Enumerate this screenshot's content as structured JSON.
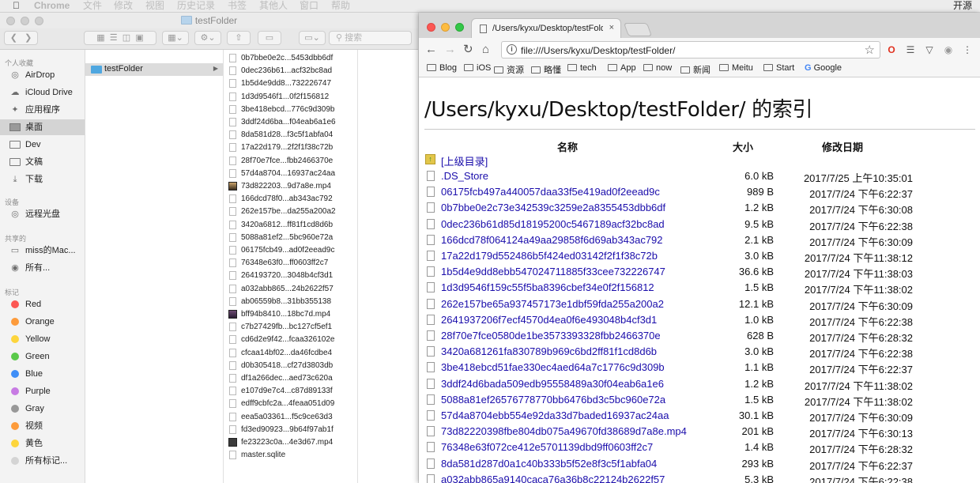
{
  "menubar": {
    "app": "Chrome",
    "items": [
      "文件",
      "修改",
      "视图",
      "历史记录",
      "书签",
      "其他人",
      "窗口",
      "帮助"
    ],
    "right_text": "开源"
  },
  "finder": {
    "title": "testFolder",
    "search_placeholder": "搜索",
    "sidebar": {
      "favorites_header": "个人收藏",
      "favorites": [
        {
          "label": "AirDrop",
          "icon": "airdrop-icon"
        },
        {
          "label": "iCloud Drive",
          "icon": "cloud-icon"
        },
        {
          "label": "应用程序",
          "icon": "applications-icon"
        },
        {
          "label": "桌面",
          "icon": "desktop-icon",
          "selected": true
        },
        {
          "label": "Dev",
          "icon": "folder-icon"
        },
        {
          "label": "文稿",
          "icon": "documents-icon"
        },
        {
          "label": "下载",
          "icon": "download-icon"
        }
      ],
      "devices_header": "设备",
      "devices": [
        {
          "label": "远程光盘",
          "icon": "disc-icon"
        }
      ],
      "shared_header": "共享的",
      "shared": [
        {
          "label": "miss的Mac...",
          "icon": "computer-icon"
        },
        {
          "label": "所有...",
          "icon": "network-icon"
        }
      ],
      "tags_header": "标记",
      "tags": [
        {
          "label": "Red",
          "color": "#fc5753"
        },
        {
          "label": "Orange",
          "color": "#fd9b3b"
        },
        {
          "label": "Yellow",
          "color": "#fdd53c"
        },
        {
          "label": "Green",
          "color": "#5ac94a"
        },
        {
          "label": "Blue",
          "color": "#3e8ef7"
        },
        {
          "label": "Purple",
          "color": "#c77be3"
        },
        {
          "label": "Gray",
          "color": "#989898"
        },
        {
          "label": "视频",
          "color": "#fd9b3b"
        },
        {
          "label": "黄色",
          "color": "#fdd53c"
        },
        {
          "label": "所有标记...",
          "color": "#d4d4d4"
        }
      ]
    },
    "column1": {
      "selected_folder": "testFolder"
    },
    "column2_files": [
      {
        "name": "0b7bbe0e2c...5453dbb6df",
        "kind": "doc"
      },
      {
        "name": "0dec236b61...acf32bc8ad",
        "kind": "doc"
      },
      {
        "name": "1b5d4e9dd8...732226747",
        "kind": "doc"
      },
      {
        "name": "1d3d9546f1...0f2f156812",
        "kind": "doc"
      },
      {
        "name": "3be418ebcd...776c9d309b",
        "kind": "doc"
      },
      {
        "name": "3ddf24d6ba...f04eab6a1e6",
        "kind": "doc"
      },
      {
        "name": "8da581d28...f3c5f1abfa04",
        "kind": "doc"
      },
      {
        "name": "17a22d179...2f2f1f38c72b",
        "kind": "doc"
      },
      {
        "name": "28f70e7fce...fbb2466370e",
        "kind": "doc"
      },
      {
        "name": "57d4a8704...16937ac24aa",
        "kind": "doc"
      },
      {
        "name": "73d822203...9d7a8e.mp4",
        "kind": "video1"
      },
      {
        "name": "166dcd78f0...ab343ac792",
        "kind": "doc"
      },
      {
        "name": "262e157be...da255a200a2",
        "kind": "doc"
      },
      {
        "name": "3420a6812...ff81f1cd8d6b",
        "kind": "doc"
      },
      {
        "name": "5088a81ef2...5bc960e72a",
        "kind": "doc"
      },
      {
        "name": "06175fcb49...ad0f2eead9c",
        "kind": "doc"
      },
      {
        "name": "76348e63f0...ff0603ff2c7",
        "kind": "doc"
      },
      {
        "name": "264193720...3048b4cf3d1",
        "kind": "doc"
      },
      {
        "name": "a032abb865...24b2622f57",
        "kind": "doc"
      },
      {
        "name": "ab06559b8...31bb355138",
        "kind": "doc"
      },
      {
        "name": "bff94b8410...18bc7d.mp4",
        "kind": "video2"
      },
      {
        "name": "c7b27429fb...bc127cf5ef1",
        "kind": "doc"
      },
      {
        "name": "cd6d2e9f42...fcaa326102e",
        "kind": "doc"
      },
      {
        "name": "cfcaa14bf02...da46fcdbe4",
        "kind": "doc"
      },
      {
        "name": "d0b305418...cf27d3803db",
        "kind": "doc"
      },
      {
        "name": "df1a266dec...aed73c620a",
        "kind": "doc"
      },
      {
        "name": "e107d9e7c4...c87d89133f",
        "kind": "doc"
      },
      {
        "name": "edff9cbfc2a...4feaa051d09",
        "kind": "doc"
      },
      {
        "name": "eea5a03361...f5c9ce63d3",
        "kind": "doc"
      },
      {
        "name": "fd3ed90923...9b64f97ab1f",
        "kind": "doc"
      },
      {
        "name": "fe23223c0a...4e3d67.mp4",
        "kind": "video3"
      },
      {
        "name": "master.sqlite",
        "kind": "doc"
      }
    ]
  },
  "chrome": {
    "tab_title": "/Users/kyxu/Desktop/testFolder/",
    "tab_close": "×",
    "url": "file:///Users/kyxu/Desktop/testFolder/",
    "bookmarks": [
      "Blog",
      "iOS",
      "资源",
      "略懂",
      "tech",
      "App",
      "now",
      "新闻",
      "Meitu",
      "Start",
      "Google"
    ],
    "page": {
      "title": "/Users/kyxu/Desktop/testFolder/ 的索引",
      "col_name": "名称",
      "col_size": "大小",
      "col_date": "修改日期",
      "parent_link": "[上级目录]",
      "entries": [
        {
          "name": ".DS_Store",
          "size": "6.0 kB",
          "date": "2017/7/25 上午10:35:01"
        },
        {
          "name": "06175fcb497a440057daa33f5e419ad0f2eead9c",
          "size": "989 B",
          "date": "2017/7/24 下午6:22:37"
        },
        {
          "name": "0b7bbe0e2c73e342539c3259e2a8355453dbb6df",
          "size": "1.2 kB",
          "date": "2017/7/24 下午6:30:08"
        },
        {
          "name": "0dec236b61d85d18195200c5467189acf32bc8ad",
          "size": "9.5 kB",
          "date": "2017/7/24 下午6:22:38"
        },
        {
          "name": "166dcd78f064124a49aa29858f6d69ab343ac792",
          "size": "2.1 kB",
          "date": "2017/7/24 下午6:30:09"
        },
        {
          "name": "17a22d179d552486b5f424ed03142f2f1f38c72b",
          "size": "3.0 kB",
          "date": "2017/7/24 下午11:38:12"
        },
        {
          "name": "1b5d4e9dd8ebb547024711885f33cee732226747",
          "size": "36.6 kB",
          "date": "2017/7/24 下午11:38:03"
        },
        {
          "name": "1d3d9546f159c55f5ba8396cbef34e0f2f156812",
          "size": "1.5 kB",
          "date": "2017/7/24 下午11:38:02"
        },
        {
          "name": "262e157be65a937457173e1dbf59fda255a200a2",
          "size": "12.1 kB",
          "date": "2017/7/24 下午6:30:09"
        },
        {
          "name": "2641937206f7ecf4570d4ea0f6e493048b4cf3d1",
          "size": "1.0 kB",
          "date": "2017/7/24 下午6:22:38"
        },
        {
          "name": "28f70e7fce0580de1be3573393328fbb2466370e",
          "size": "628 B",
          "date": "2017/7/24 下午6:28:32"
        },
        {
          "name": "3420a681261fa830789b969c6bd2ff81f1cd8d6b",
          "size": "3.0 kB",
          "date": "2017/7/24 下午6:22:38"
        },
        {
          "name": "3be418ebcd51fae330ec4aed64a7c1776c9d309b",
          "size": "1.1 kB",
          "date": "2017/7/24 下午6:22:37"
        },
        {
          "name": "3ddf24d6bada509edb95558489a30f04eab6a1e6",
          "size": "1.2 kB",
          "date": "2017/7/24 下午11:38:02"
        },
        {
          "name": "5088a81ef26576778770bb6476bd3c5bc960e72a",
          "size": "1.5 kB",
          "date": "2017/7/24 下午11:38:02"
        },
        {
          "name": "57d4a8704ebb554e92da33d7baded16937ac24aa",
          "size": "30.1 kB",
          "date": "2017/7/24 下午6:30:09"
        },
        {
          "name": "73d82220398fbe804db075a49670fd38689d7a8e.mp4",
          "size": "201 kB",
          "date": "2017/7/24 下午6:30:13"
        },
        {
          "name": "76348e63f072ce412e5701139dbd9ff0603ff2c7",
          "size": "1.4 kB",
          "date": "2017/7/24 下午6:28:32"
        },
        {
          "name": "8da581d287d0a1c40b333b5f52e8f3c5f1abfa04",
          "size": "293 kB",
          "date": "2017/7/24 下午6:22:37"
        },
        {
          "name": "a032abb865a9140caca76a36b8c22124b2622f57",
          "size": "5.3 kB",
          "date": "2017/7/24 下午6:22:38"
        }
      ]
    }
  }
}
